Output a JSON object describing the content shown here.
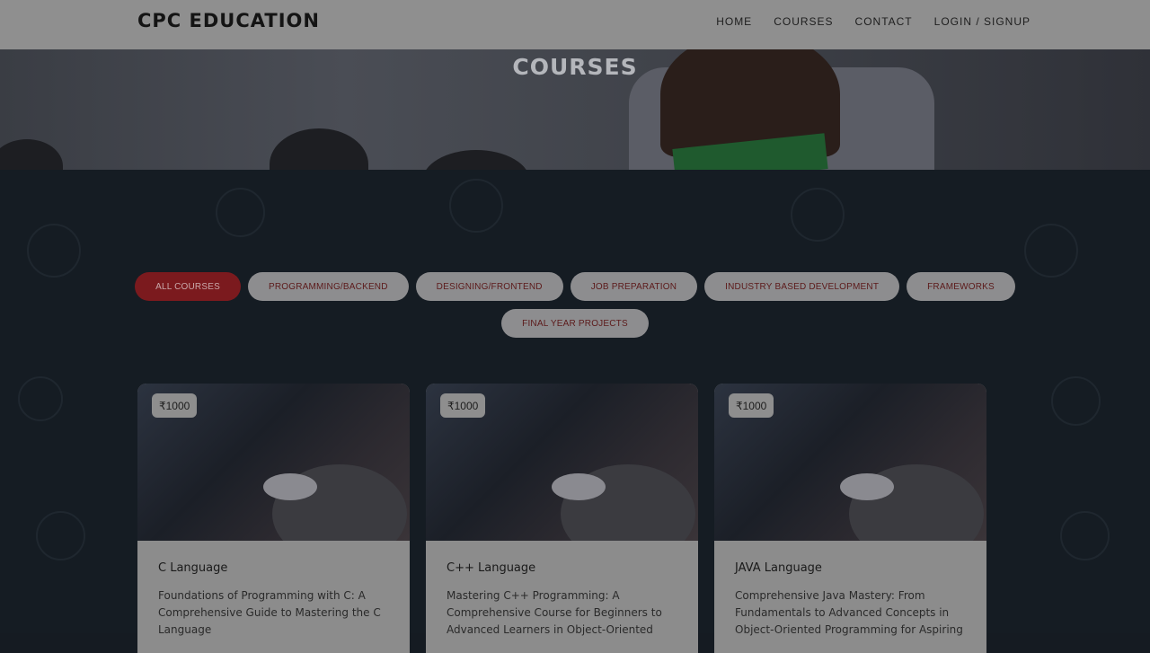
{
  "header": {
    "logo": "CPC EDUCATION",
    "nav": [
      "HOME",
      "COURSES",
      "CONTACT",
      "LOGIN / SIGNUP"
    ]
  },
  "hero": {
    "title": "COURSES"
  },
  "filters": {
    "row1": [
      "ALL COURSES",
      "PROGRAMMING/BACKEND",
      "DESIGNING/FRONTEND",
      "JOB PREPARATION",
      "INDUSTRY BASED DEVELOPMENT",
      "FRAMEWORKS"
    ],
    "row2": [
      "FINAL YEAR PROJECTS"
    ],
    "active": "ALL COURSES"
  },
  "courses": [
    {
      "price": "₹1000",
      "title": "C Language",
      "description": "Foundations of Programming with C: A Comprehensive Guide to Mastering the C Language"
    },
    {
      "price": "₹1000",
      "title": "C++ Language",
      "description": "Mastering C++ Programming: A Comprehensive Course for Beginners to Advanced Learners in Object-Oriented"
    },
    {
      "price": "₹1000",
      "title": "JAVA Language",
      "description": "Comprehensive Java Mastery: From Fundamentals to Advanced Concepts in Object-Oriented Programming for Aspiring"
    }
  ],
  "colors": {
    "accent": "#7b1a1e",
    "overlay": "#151c23"
  }
}
